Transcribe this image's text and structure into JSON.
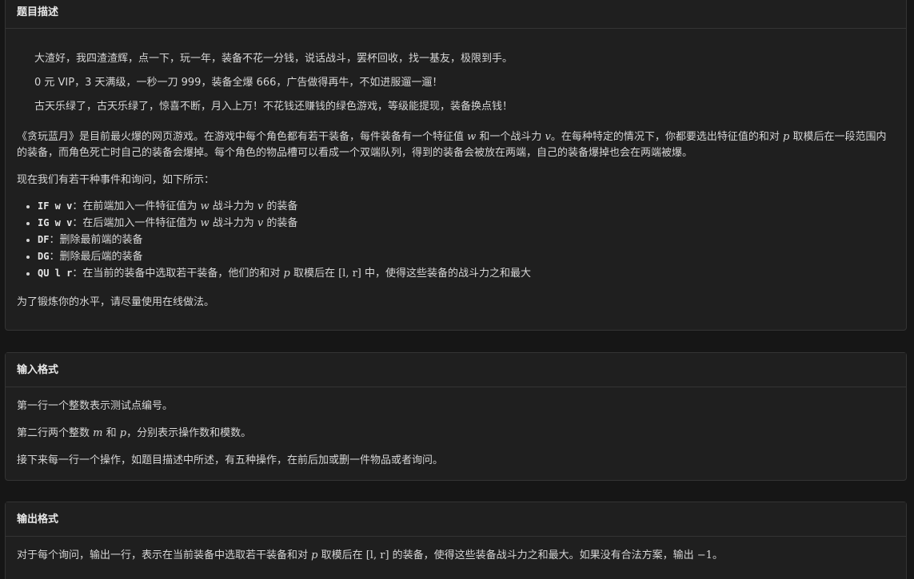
{
  "description": {
    "header": "题目描述",
    "quote": [
      "大渣好，我四渣渣辉，点一下，玩一年，装备不花一分钱，说话战斗，罢杯回收，找一基友，极限到手。",
      "0 元 VIP，3 天满级，一秒一刀 999，装备全爆 666，广告做得再牛，不如进服遛一遛！",
      "古天乐绿了，古天乐绿了，惊喜不断，月入上万！不花钱还赚钱的绿色游戏，等级能提现，装备换点钱！"
    ],
    "para1": {
      "a": "《贪玩蓝月》是目前最火爆的网页游戏。在游戏中每个角色都有若干装备，每件装备有一个特征值 ",
      "w": "w",
      "b": " 和一个战斗力 ",
      "v": "v",
      "c": "。在每种特定的情况下，你都要选出特征值的和对 ",
      "p": "p",
      "d": " 取模后在一段范围内的装备，而角色死亡时自己的装备会爆掉。每个角色的物品槽可以看成一个双端队列，得到的装备会被放在两端，自己的装备爆掉也会在两端被爆。"
    },
    "para2": "现在我们有若干种事件和询问，如下所示：",
    "ops": [
      {
        "code": "IF w v",
        "a": "：在前端加入一件特征值为 ",
        "m1": "w",
        "b": " 战斗力为 ",
        "m2": "v",
        "c": " 的装备"
      },
      {
        "code": "IG w v",
        "a": "：在后端加入一件特征值为 ",
        "m1": "w",
        "b": " 战斗力为 ",
        "m2": "v",
        "c": " 的装备"
      },
      {
        "code": "DF",
        "a": "：删除最前端的装备"
      },
      {
        "code": "DG",
        "a": "：删除最后端的装备"
      },
      {
        "code": "QU l r",
        "a": "：在当前的装备中选取若干装备，他们的和对 ",
        "m1": "p",
        "b": " 取模后在 ",
        "m2": "[l, r]",
        "c": " 中，使得这些装备的战斗力之和最大"
      }
    ],
    "para3": "为了锻炼你的水平，请尽量使用在线做法。"
  },
  "input": {
    "header": "输入格式",
    "line1": "第一行一个整数表示测试点编号。",
    "line2": {
      "a": "第二行两个整数 ",
      "m": "m",
      "b": " 和 ",
      "p": "p",
      "c": "，分别表示操作数和模数。"
    },
    "line3": "接下来每一行一个操作，如题目描述中所述，有五种操作，在前后加或删一件物品或者询问。"
  },
  "output": {
    "header": "输出格式",
    "line1": {
      "a": "对于每个询问，输出一行，表示在当前装备中选取若干装备和对 ",
      "p": "p",
      "b": " 取模后在 ",
      "lr": "[l, r]",
      "c": " 的装备，使得这些装备战斗力之和最大。如果没有合法方案，输出 ",
      "neg": "−1",
      "d": "。"
    }
  }
}
